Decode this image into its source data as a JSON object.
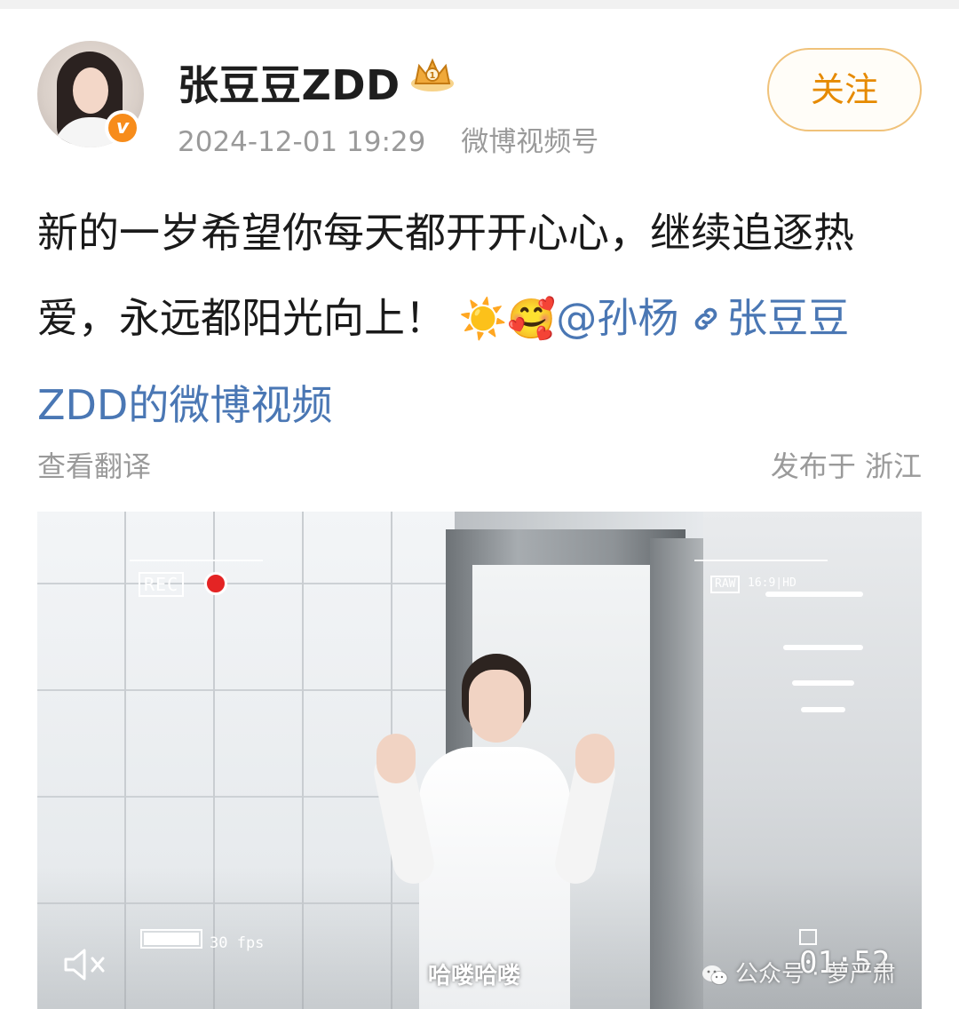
{
  "user": {
    "name": "张豆豆ZDD",
    "verified_badge": "v",
    "timestamp": "2024-12-01 19:29",
    "source": "微博视频号",
    "follow_label": "关注"
  },
  "post": {
    "text": "新的一岁希望你每天都开开心心，继续追逐热爱，永远都阳光向上！",
    "emoji": [
      "☀️",
      "🥰"
    ],
    "mention": "@孙杨",
    "link_text": "张豆豆ZDD的微博视频",
    "link_icon": "link-icon"
  },
  "actions": {
    "translate_label": "查看翻译",
    "location_label": "发布于 浙江"
  },
  "video": {
    "rec_label": "REC",
    "raw_label": "RAW",
    "raw_info": "16:9|HD",
    "fps_label": "30 fps",
    "subtitle": "哈喽哈喽",
    "timer": "01:52",
    "battery_level": 1.0,
    "mute_icon": "speaker-muted-icon"
  },
  "watermark": {
    "text": "公众号 · 萝严肃",
    "icon": "wechat-icon"
  },
  "colors": {
    "follow_border": "#f0c27a",
    "follow_text": "#e68a00",
    "link_blue": "#4a77b4",
    "meta_gray": "#9a9a9a",
    "verified_orange": "#f78c1b",
    "rec_red": "#e42424"
  }
}
